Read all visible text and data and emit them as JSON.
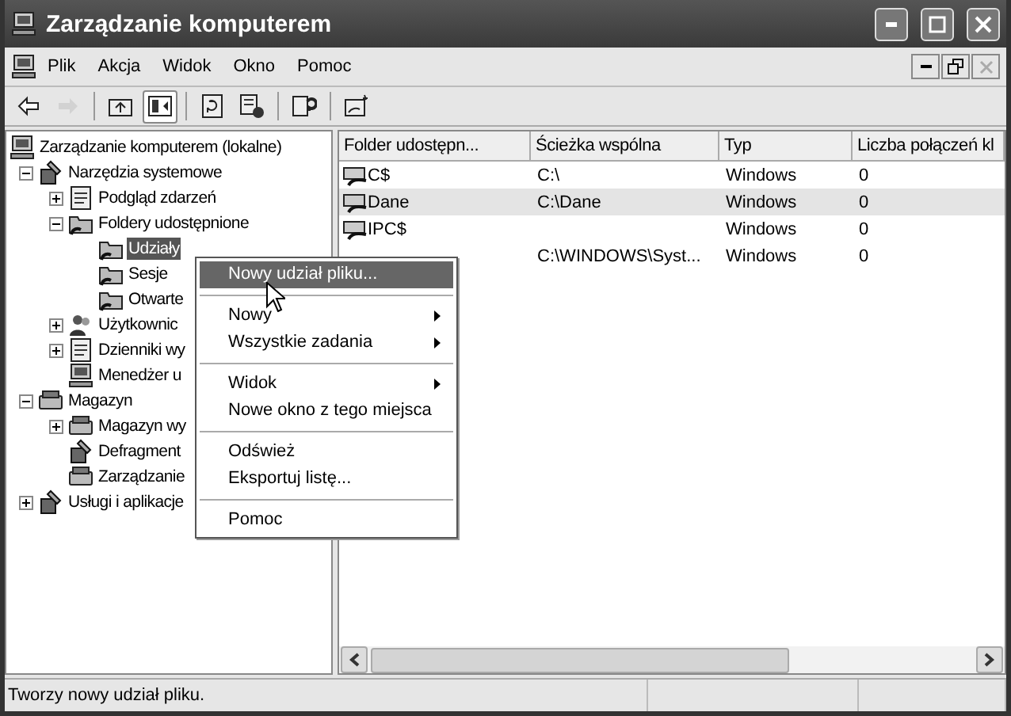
{
  "window": {
    "title": "Zarządzanie komputerem"
  },
  "menu": [
    "Plik",
    "Akcja",
    "Widok",
    "Okno",
    "Pomoc"
  ],
  "toolbar": [
    {
      "disabled": false,
      "pressed": false
    },
    {
      "disabled": true,
      "pressed": false
    },
    {
      "disabled": false,
      "pressed": false
    },
    {
      "disabled": false,
      "pressed": true
    },
    {
      "disabled": false,
      "pressed": false
    },
    {
      "disabled": false,
      "pressed": false
    },
    {
      "disabled": false,
      "pressed": false
    },
    {
      "disabled": false,
      "pressed": false
    }
  ],
  "tree": [
    {
      "label": "Zarządzanie komputerem (lokalne)",
      "selected": false,
      "children": [
        {
          "label": "Narzędzia systemowe",
          "expanded": true,
          "selected": false,
          "children": [
            {
              "label": "Podgląd zdarzeń",
              "expanded": false,
              "selected": false
            },
            {
              "label": "Foldery udostępnione",
              "expanded": true,
              "selected": false,
              "children": [
                {
                  "label": "Udziały",
                  "selected": true
                },
                {
                  "label": "Sesje",
                  "selected": false
                },
                {
                  "label": "Otwarte",
                  "selected": false
                }
              ]
            },
            {
              "label": "Użytkownic",
              "expanded": false,
              "selected": false
            },
            {
              "label": "Dzienniki wy",
              "expanded": false,
              "selected": false
            },
            {
              "label": "Menedżer u",
              "selected": false
            }
          ]
        },
        {
          "label": "Magazyn",
          "expanded": true,
          "selected": false,
          "children": [
            {
              "label": "Magazyn wy",
              "expanded": false,
              "selected": false
            },
            {
              "label": "Defragment",
              "selected": false
            },
            {
              "label": "Zarządzanie",
              "selected": false
            }
          ]
        },
        {
          "label": "Usługi i aplikacje",
          "expanded": false,
          "selected": false
        }
      ]
    }
  ],
  "table": {
    "columns": [
      "Folder udostępn...",
      "Ścieżka wspólna",
      "Typ",
      "Liczba połączeń kl"
    ],
    "rows": [
      {
        "cells": [
          "C$",
          "C:\\",
          "Windows",
          "0"
        ],
        "selected": false
      },
      {
        "cells": [
          "Dane",
          "C:\\Dane",
          "Windows",
          "0"
        ],
        "selected": true
      },
      {
        "cells": [
          "IPC$",
          null,
          "Windows",
          "0"
        ],
        "selected": false
      },
      {
        "cells": [
          null,
          "C:\\WINDOWS\\Syst...",
          "Windows",
          "0"
        ],
        "selected": false
      }
    ]
  },
  "context_menu": [
    {
      "kind": "item",
      "label": "Nowy udział pliku...",
      "selected": true,
      "submenu": false
    },
    {
      "kind": "separator"
    },
    {
      "kind": "item",
      "label": "Nowy",
      "selected": false,
      "submenu": true
    },
    {
      "kind": "item",
      "label": "Wszystkie zadania",
      "selected": false,
      "submenu": true
    },
    {
      "kind": "separator"
    },
    {
      "kind": "item",
      "label": "Widok",
      "selected": false,
      "submenu": true
    },
    {
      "kind": "item",
      "label": "Nowe okno z tego miejsca",
      "selected": false,
      "submenu": false
    },
    {
      "kind": "separator"
    },
    {
      "kind": "item",
      "label": "Odśwież",
      "selected": false,
      "submenu": false
    },
    {
      "kind": "item",
      "label": "Eksportuj listę...",
      "selected": false,
      "submenu": false
    },
    {
      "kind": "separator"
    },
    {
      "kind": "item",
      "label": "Pomoc",
      "selected": false,
      "submenu": false
    }
  ],
  "status_bar": {
    "text": "Tworzy nowy udział pliku."
  }
}
